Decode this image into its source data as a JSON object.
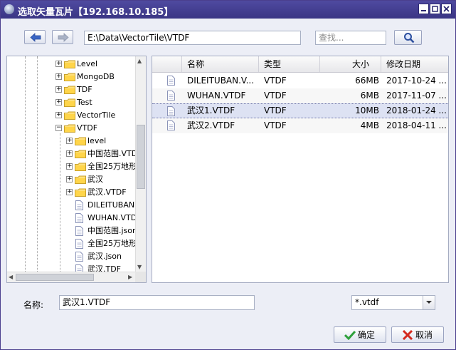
{
  "window": {
    "title": "选取矢量瓦片【192.168.10.185】"
  },
  "toolbar": {
    "path": "E:\\Data\\VectorTile\\VTDF",
    "search_placeholder": "查找..."
  },
  "tree": {
    "items": [
      {
        "label": "Level",
        "kind": "folder",
        "level": 1,
        "expander": "+"
      },
      {
        "label": "MongoDB",
        "kind": "folder",
        "level": 1,
        "expander": "+"
      },
      {
        "label": "TDF",
        "kind": "folder",
        "level": 1,
        "expander": "+"
      },
      {
        "label": "Test",
        "kind": "folder",
        "level": 1,
        "expander": "+"
      },
      {
        "label": "VectorTile",
        "kind": "folder",
        "level": 1,
        "expander": "+"
      },
      {
        "label": "VTDF",
        "kind": "folder",
        "level": 1,
        "expander": "-"
      },
      {
        "label": "level",
        "kind": "folder",
        "level": 2,
        "expander": "+"
      },
      {
        "label": "中国范围.VTD",
        "kind": "folder",
        "level": 2,
        "expander": "+"
      },
      {
        "label": "全国25万地形",
        "kind": "folder",
        "level": 2,
        "expander": "+"
      },
      {
        "label": "武汉",
        "kind": "folder",
        "level": 2,
        "expander": "+"
      },
      {
        "label": "武汉.VTDF",
        "kind": "folder",
        "level": 2,
        "expander": "+"
      },
      {
        "label": "DILEITUBAN.",
        "kind": "file",
        "level": 2,
        "expander": ""
      },
      {
        "label": "WUHAN.VTD",
        "kind": "file",
        "level": 2,
        "expander": ""
      },
      {
        "label": "中国范围.json",
        "kind": "file",
        "level": 2,
        "expander": ""
      },
      {
        "label": "全国25万地形",
        "kind": "file",
        "level": 2,
        "expander": ""
      },
      {
        "label": "武汉.json",
        "kind": "file",
        "level": 2,
        "expander": ""
      },
      {
        "label": "武汉.TDF",
        "kind": "file",
        "level": 2,
        "expander": ""
      }
    ]
  },
  "list": {
    "columns": [
      "名称",
      "类型",
      "大小",
      "修改日期"
    ],
    "rows": [
      {
        "name": "DILEITUBAN.V...",
        "type": "VTDF",
        "size": "66MB",
        "date": "2017-10-24 ..."
      },
      {
        "name": "WUHAN.VTDF",
        "type": "VTDF",
        "size": "6MB",
        "date": "2017-11-07 ..."
      },
      {
        "name": "武汉1.VTDF",
        "type": "VTDF",
        "size": "10MB",
        "date": "2018-01-24 ..."
      },
      {
        "name": "武汉2.VTDF",
        "type": "VTDF",
        "size": "4MB",
        "date": "2018-04-11 ..."
      }
    ],
    "selected_index": 2
  },
  "footer": {
    "name_label": "名称:",
    "name_value": "武汉1.VTDF",
    "filter_value": "*.vtdf",
    "ok_label": "确定",
    "cancel_label": "取消"
  }
}
